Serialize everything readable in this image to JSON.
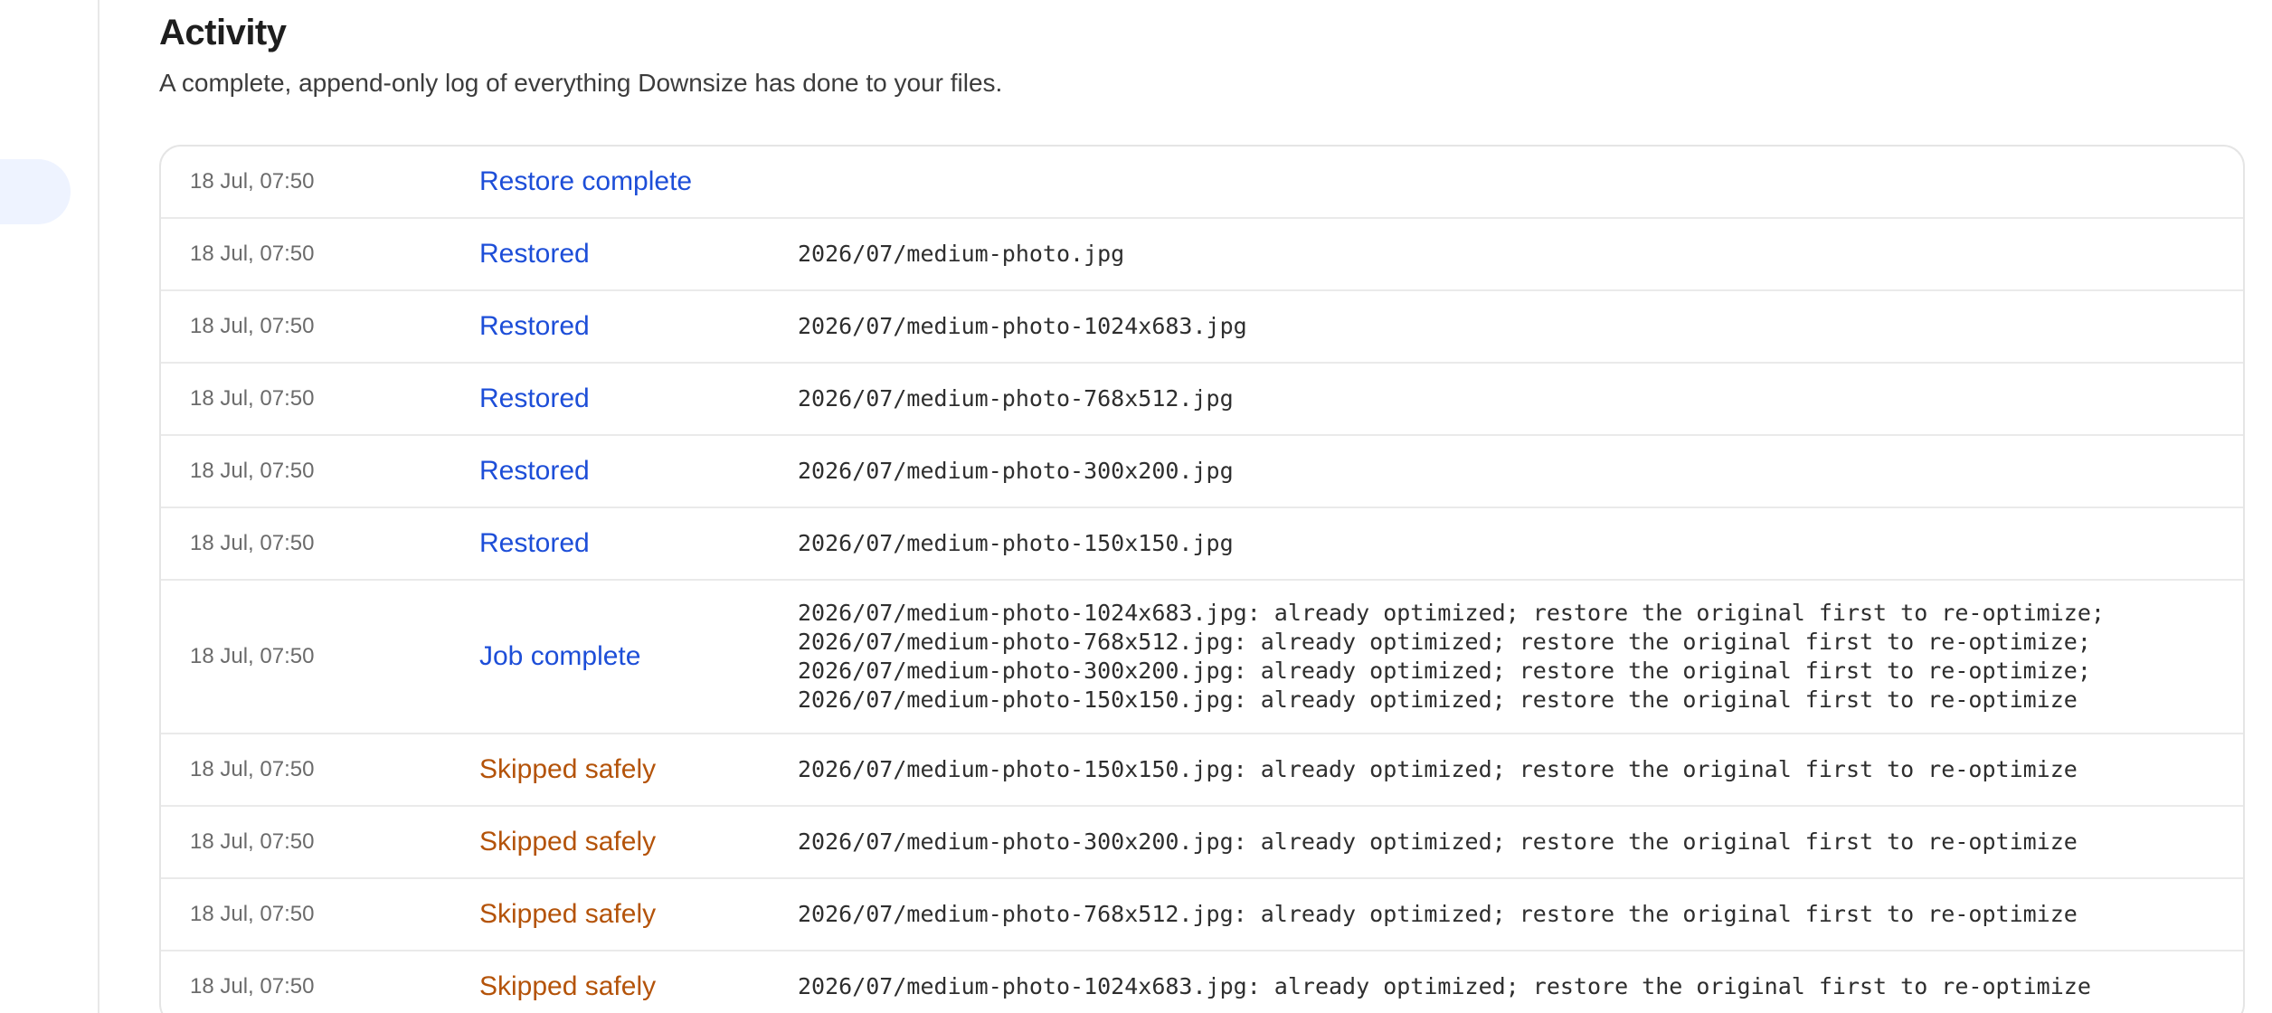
{
  "page": {
    "title": "Activity",
    "subtitle": "A complete, append-only log of everything Downsize has done to your files."
  },
  "colors": {
    "info_event": "#1d4ed8",
    "warn_event": "#b45309",
    "sidebar_active": "#eef3ff"
  },
  "log": [
    {
      "time": "18 Jul, 07:50",
      "event": "Restore complete",
      "detail": ""
    },
    {
      "time": "18 Jul, 07:50",
      "event": "Restored",
      "detail": "2026/07/medium-photo.jpg"
    },
    {
      "time": "18 Jul, 07:50",
      "event": "Restored",
      "detail": "2026/07/medium-photo-1024x683.jpg"
    },
    {
      "time": "18 Jul, 07:50",
      "event": "Restored",
      "detail": "2026/07/medium-photo-768x512.jpg"
    },
    {
      "time": "18 Jul, 07:50",
      "event": "Restored",
      "detail": "2026/07/medium-photo-300x200.jpg"
    },
    {
      "time": "18 Jul, 07:50",
      "event": "Restored",
      "detail": "2026/07/medium-photo-150x150.jpg"
    },
    {
      "time": "18 Jul, 07:50",
      "event": "Job complete",
      "detail": "2026/07/medium-photo-1024x683.jpg: already optimized; restore the original first to re-optimize;\n2026/07/medium-photo-768x512.jpg: already optimized; restore the original first to re-optimize;\n2026/07/medium-photo-300x200.jpg: already optimized; restore the original first to re-optimize;\n2026/07/medium-photo-150x150.jpg: already optimized; restore the original first to re-optimize"
    },
    {
      "time": "18 Jul, 07:50",
      "event": "Skipped safely",
      "detail": "2026/07/medium-photo-150x150.jpg: already optimized; restore the original first to re-optimize"
    },
    {
      "time": "18 Jul, 07:50",
      "event": "Skipped safely",
      "detail": "2026/07/medium-photo-300x200.jpg: already optimized; restore the original first to re-optimize"
    },
    {
      "time": "18 Jul, 07:50",
      "event": "Skipped safely",
      "detail": "2026/07/medium-photo-768x512.jpg: already optimized; restore the original first to re-optimize"
    },
    {
      "time": "18 Jul, 07:50",
      "event": "Skipped safely",
      "detail": "2026/07/medium-photo-1024x683.jpg: already optimized; restore the original first to re-optimize"
    }
  ]
}
